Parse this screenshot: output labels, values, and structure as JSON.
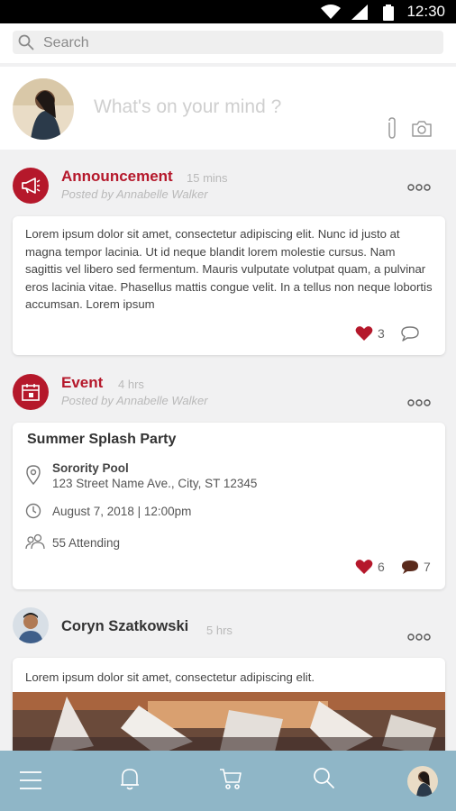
{
  "status_bar": {
    "time": "12:30"
  },
  "search": {
    "placeholder": "Search"
  },
  "composer": {
    "prompt": "What's on your mind ?"
  },
  "posts": [
    {
      "title": "Announcement",
      "time": "15 mins",
      "posted_by": "Posted by Annabelle Walker",
      "body": "Lorem ipsum dolor sit amet, consectetur adipiscing elit. Nunc id justo at magna tempor lacinia. Ut id neque blandit lorem molestie cursus. Nam sagittis vel libero sed fermentum. Mauris vulputate volutpat quam, a pulvinar eros lacinia vitae. Phasellus mattis congue velit. In a tellus non neque lobortis accumsan. Lorem ipsum",
      "likes": "3"
    },
    {
      "title": "Event",
      "time": "4 hrs",
      "posted_by": "Posted by Annabelle Walker",
      "event_name": "Summer Splash Party",
      "location_name": "Sorority Pool",
      "address": "123 Street Name Ave., City, ST 12345",
      "datetime": "August 7, 2018 | 12:00pm",
      "attending": "55 Attending",
      "likes": "6",
      "comments": "7"
    },
    {
      "author": "Coryn Szatkowski",
      "time": "5 hrs",
      "body": "Lorem ipsum dolor sit amet, consectetur adipiscing elit."
    }
  ],
  "colors": {
    "accent": "#b5182b",
    "nav_bg": "#8fb6c7"
  },
  "icons": [
    "search-icon",
    "paperclip-icon",
    "camera-icon",
    "megaphone-icon",
    "calendar-icon",
    "more-icon",
    "heart-icon",
    "comment-icon",
    "location-icon",
    "clock-icon",
    "people-icon",
    "menu-icon",
    "bell-icon",
    "cart-icon"
  ]
}
